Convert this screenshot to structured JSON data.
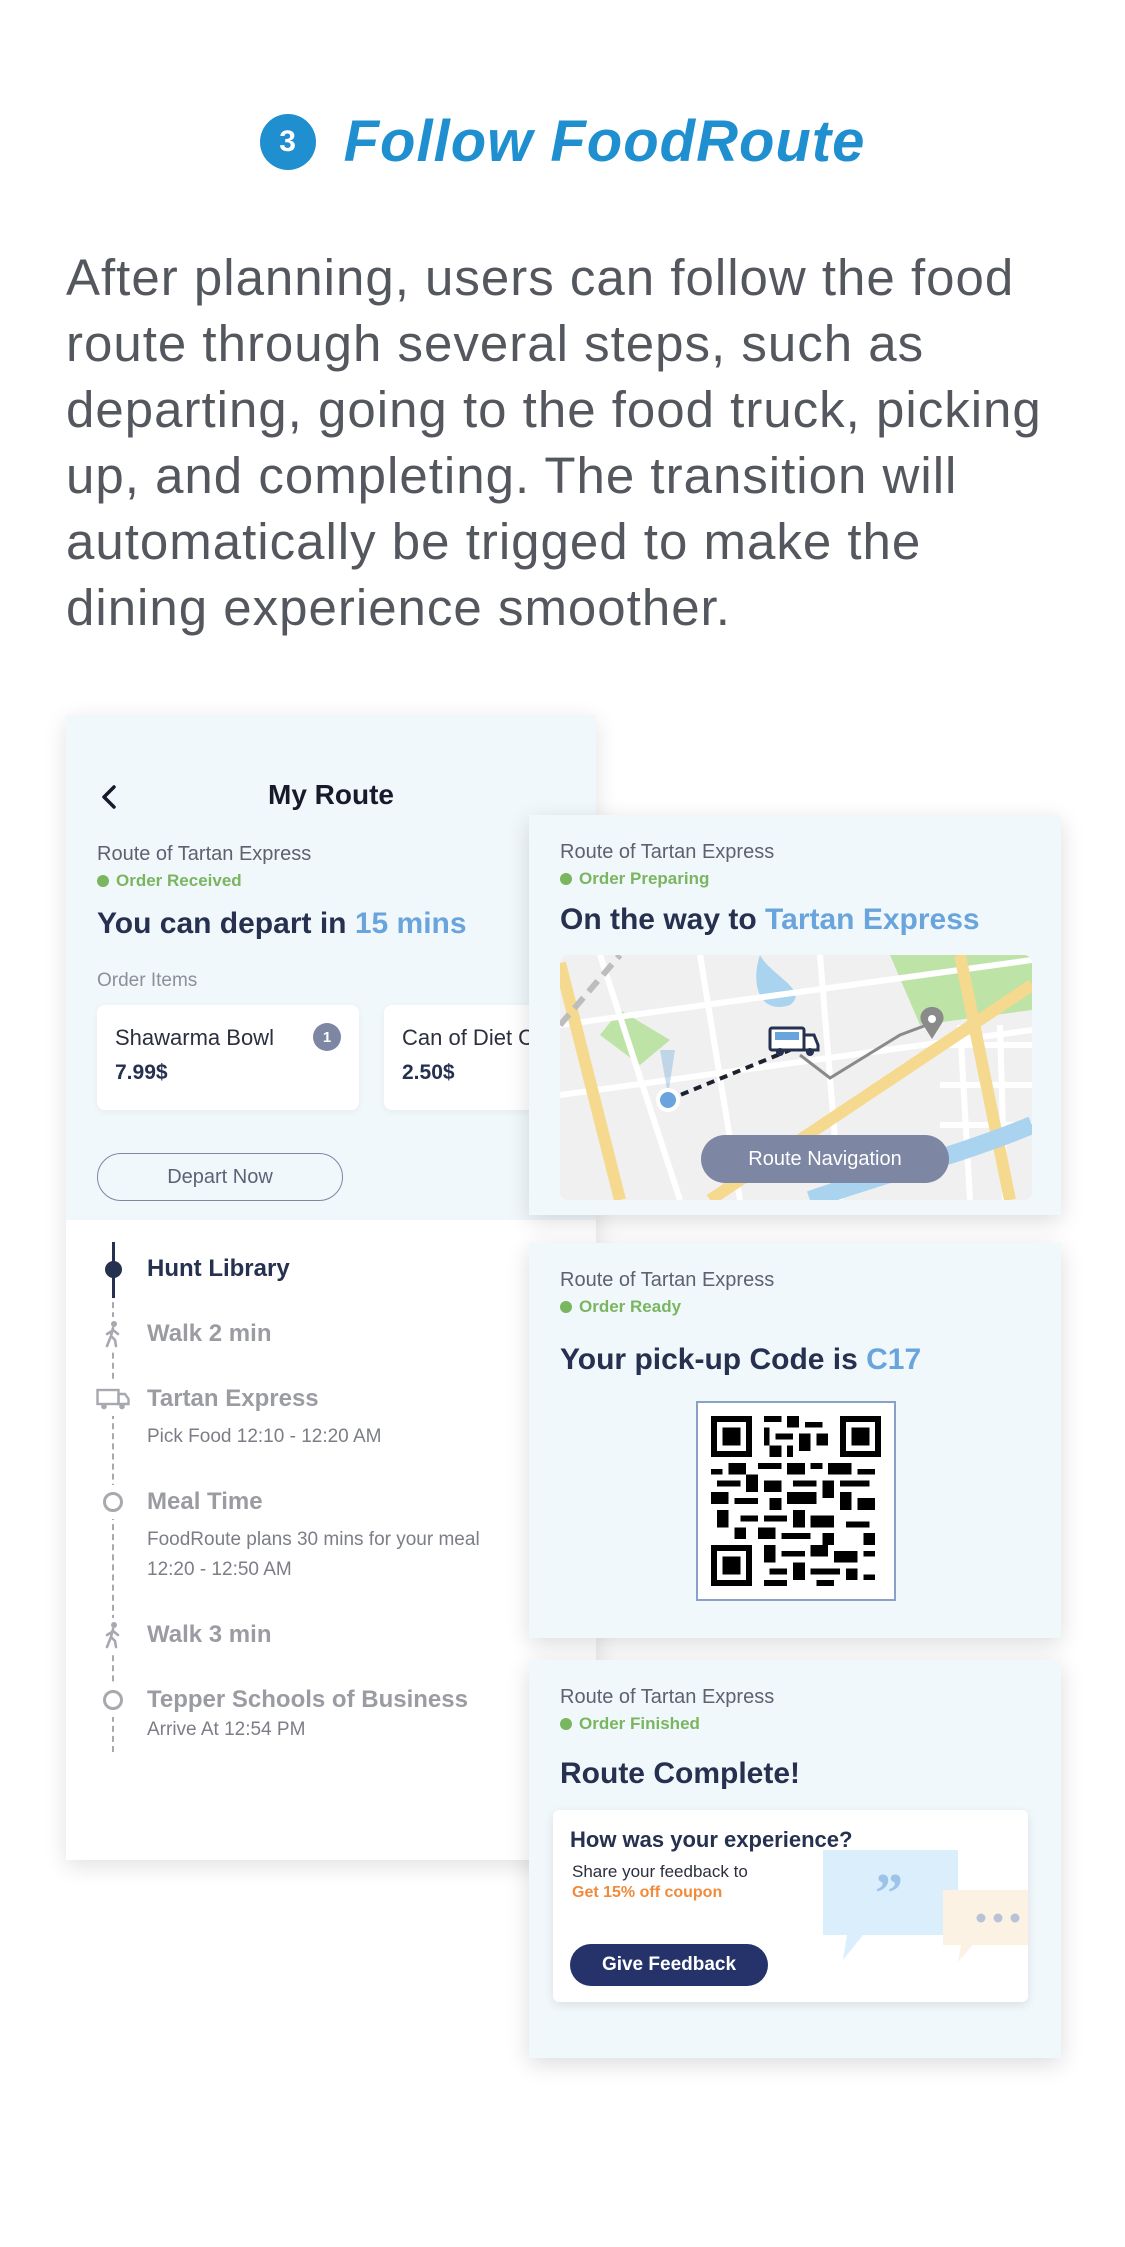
{
  "header": {
    "step_number": "3",
    "title": "Follow FoodRoute",
    "description": "After planning, users can follow the food route through several steps, such as departing, going to the food truck, picking up, and completing. The transition will automatically be trigged to make the dining experience smoother."
  },
  "my_route": {
    "title": "My Route",
    "route_of": "Route of Tartan Express",
    "status": "Order Received",
    "headline_prefix": "You can depart in ",
    "headline_accent": "15 mins",
    "order_items_label": "Order Items",
    "items": [
      {
        "name": "Shawarma Bowl",
        "price": "7.99$",
        "qty": "1"
      },
      {
        "name": "Can of Diet Coke",
        "price": "2.50$"
      }
    ],
    "depart_button": "Depart Now",
    "timeline": {
      "hunt": "Hunt Library",
      "walk1": "Walk 2 min",
      "truck": "Tartan Express",
      "truck_sub": "Pick Food  12:10 - 12:20 AM",
      "meal": "Meal Time",
      "meal_sub1": "FoodRoute plans 30 mins for your meal",
      "meal_sub2": "12:20 - 12:50 AM",
      "walk2": "Walk 3 min",
      "dest": "Tepper Schools of Business",
      "dest_sub": "Arrive At  12:54 PM"
    }
  },
  "card_preparing": {
    "route_of": "Route of Tartan Express",
    "status": "Order Preparing",
    "headline_prefix": "On the way to ",
    "headline_accent": "Tartan Express",
    "button": "Route Navigation"
  },
  "card_ready": {
    "route_of": "Route of Tartan Express",
    "status": "Order Ready",
    "headline_prefix": "Your pick-up Code is ",
    "headline_accent": "C17"
  },
  "card_finished": {
    "route_of": "Route of Tartan Express",
    "status": "Order Finished",
    "headline": "Route Complete!",
    "question": "How was your experience?",
    "share": "Share your feedback to",
    "coupon": "Get 15% off coupon",
    "button": "Give Feedback"
  },
  "colors": {
    "brand_blue": "#1f8fcf",
    "accent_blue": "#6aa4dc",
    "navy": "#26304f",
    "status_green": "#7ab55f",
    "coupon_orange": "#f08a3c",
    "card_bg": "#f1f8fc"
  },
  "icons": [
    "back-chevron-icon",
    "pedestrian-icon",
    "food-truck-icon",
    "ring-icon",
    "map-pin-icon",
    "quote-bubble-icon"
  ]
}
